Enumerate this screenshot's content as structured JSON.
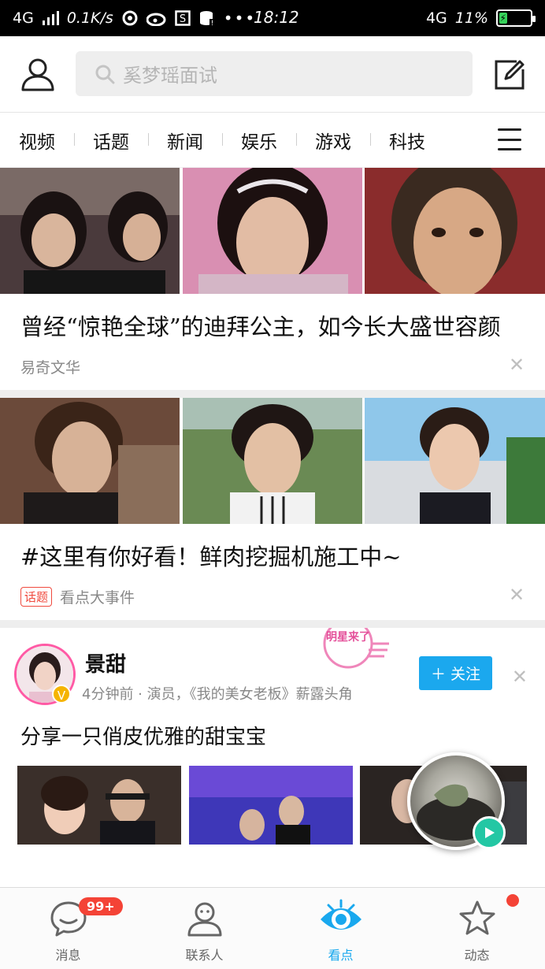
{
  "status_bar": {
    "network_left": "4G",
    "speed": "0.1K/s",
    "time": "18:12",
    "network_right": "4G",
    "battery": "11%",
    "battery_level": 0.11
  },
  "header": {
    "search_placeholder": "奚梦瑶面试"
  },
  "tabs": [
    "视频",
    "话题",
    "新闻",
    "娱乐",
    "游戏",
    "科技"
  ],
  "articles": [
    {
      "title": "曾经“惊艳全球”的迪拜公主，如今长大盛世容颜",
      "source": "易奇文华",
      "tag": ""
    },
    {
      "title": "#这里有你好看！鲜肉挖掘机施工中~",
      "source": "看点大事件",
      "tag": "话题"
    }
  ],
  "post": {
    "author": "景甜",
    "meta": "4分钟前 · 演员，《我的美女老板》薪露头角",
    "stamp": "明星来了",
    "follow_label": "关注",
    "text": "分享一只俏皮优雅的甜宝宝"
  },
  "bottom_nav": {
    "items": [
      {
        "label": "消息",
        "badge": "99+"
      },
      {
        "label": "联系人"
      },
      {
        "label": "看点"
      },
      {
        "label": "动态"
      }
    ],
    "active": "看点"
  },
  "colors": {
    "accent": "#19a8ee",
    "follow_button": "#1ba8ee",
    "badge": "#f44336",
    "topic_tag": "#f04a3e"
  }
}
